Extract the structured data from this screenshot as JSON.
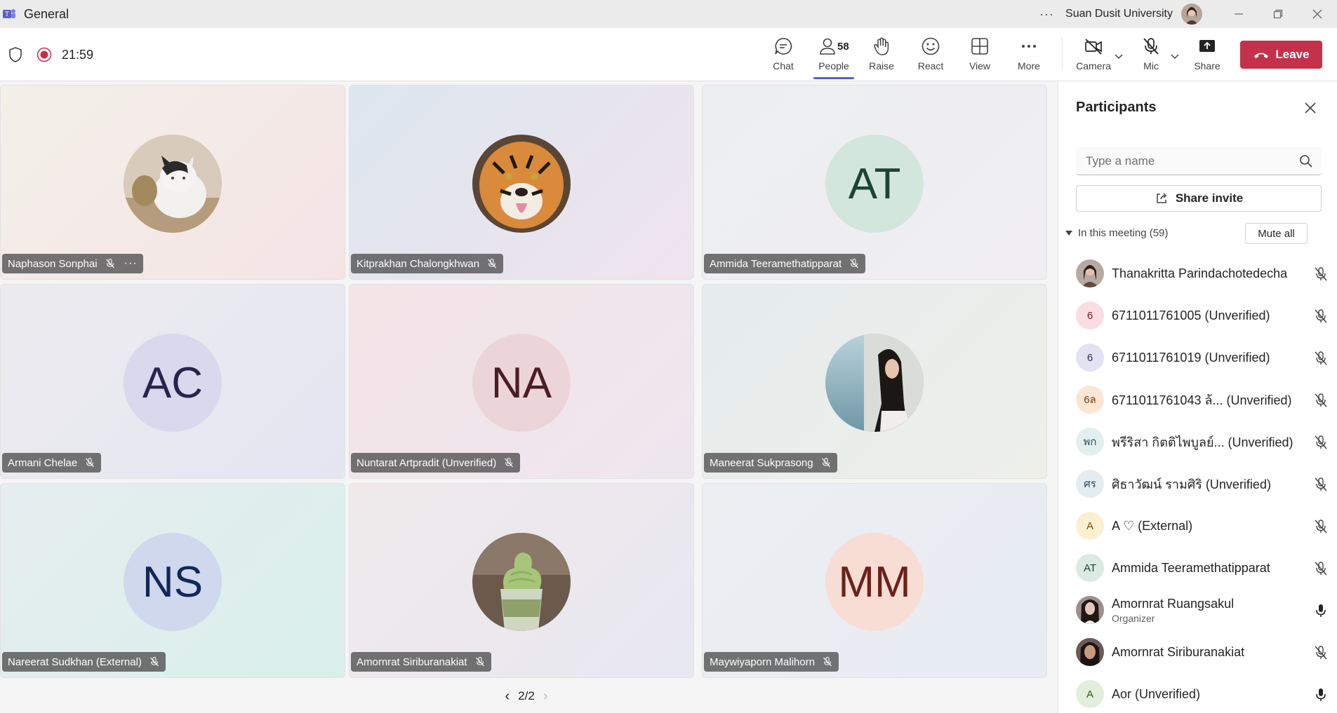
{
  "window": {
    "title": "General",
    "org": "Suan Dusit University",
    "more": "···"
  },
  "toolbar": {
    "timer": "21:59",
    "chat": "Chat",
    "people": "People",
    "people_count": "58",
    "raise": "Raise",
    "react": "React",
    "view": "View",
    "more": "More",
    "camera": "Camera",
    "mic": "Mic",
    "share": "Share",
    "leave": "Leave"
  },
  "tiles": [
    {
      "name": "Naphason Sonphai",
      "initials": "",
      "kind": "cat",
      "bg": "#f4ece9"
    },
    {
      "name": "Kitprakhan Chalongkhwan",
      "initials": "",
      "kind": "tiger",
      "bg": "#e3eaf1"
    },
    {
      "name": "Ammida Teeramethatipparat",
      "initials": "AT",
      "kind": "initials",
      "bg": "#eef0f0"
    },
    {
      "name": "Armani Chelae",
      "initials": "AC",
      "kind": "initials",
      "bg": "#ebebf2"
    },
    {
      "name": "Nuntarat Artpradit (Unverified)",
      "initials": "NA",
      "kind": "initials",
      "bg": "#f2e6ea"
    },
    {
      "name": "Maneerat Sukprasong",
      "initials": "",
      "kind": "photo",
      "bg": "#e9eeef"
    },
    {
      "name": "Nareerat Sudkhan (External)",
      "initials": "NS",
      "kind": "initials",
      "bg": "#e2efef"
    },
    {
      "name": "Amornrat Siriburanakiat",
      "initials": "",
      "kind": "icecream",
      "bg": "#ecebf0"
    },
    {
      "name": "Maywiyaporn Malihorn",
      "initials": "MM",
      "kind": "initials",
      "bg": "#ebeef2"
    }
  ],
  "tile_dots": "···",
  "pager": {
    "prev": "‹",
    "label": "2/2",
    "next": "›"
  },
  "panel": {
    "title": "Participants",
    "search_placeholder": "Type a name",
    "share_invite": "Share invite",
    "section": "In this meeting (59)",
    "mute_all": "Mute all",
    "participants": [
      {
        "name": "Thanakritta Parindachotedecha",
        "initials": "",
        "role": "",
        "mic": "muted"
      },
      {
        "name": "6711011761005 (Unverified)",
        "initials": "6",
        "role": "",
        "mic": "muted"
      },
      {
        "name": "6711011761019 (Unverified)",
        "initials": "6",
        "role": "",
        "mic": "muted"
      },
      {
        "name": "6711011761043 ล้... (Unverified)",
        "initials": "6ล",
        "role": "",
        "mic": "muted"
      },
      {
        "name": "พรีริสา กิตติไพบูลย์... (Unverified)",
        "initials": "พก",
        "role": "",
        "mic": "muted"
      },
      {
        "name": "ศิธาวัฒน์ รามศิริ (Unverified)",
        "initials": "ศร",
        "role": "",
        "mic": "muted"
      },
      {
        "name": "A ♡ (External)",
        "initials": "A",
        "role": "",
        "mic": "muted"
      },
      {
        "name": "Ammida Teeramethatipparat",
        "initials": "AT",
        "role": "",
        "mic": "muted"
      },
      {
        "name": "Amornrat Ruangsakul",
        "initials": "",
        "role": "Organizer",
        "mic": "on"
      },
      {
        "name": "Amornrat Siriburanakiat",
        "initials": "",
        "role": "",
        "mic": "muted"
      },
      {
        "name": "Aor (Unverified)",
        "initials": "A",
        "role": "",
        "mic": "on"
      }
    ]
  }
}
